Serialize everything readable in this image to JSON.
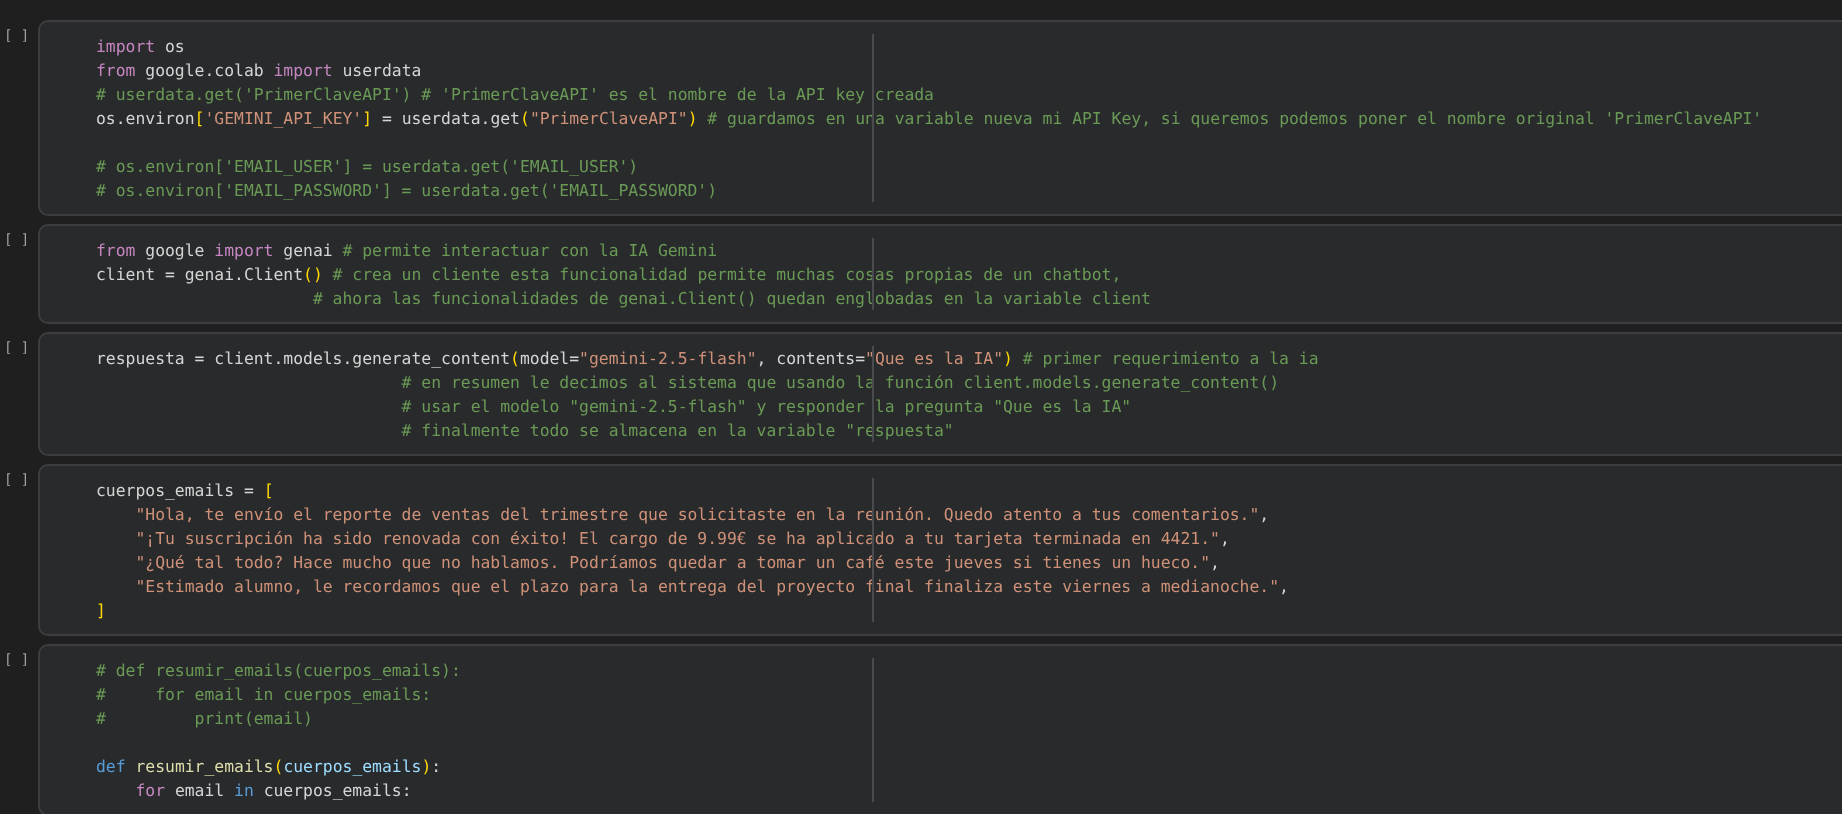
{
  "cells": [
    {
      "run_label": "[ ]",
      "lines": [
        {
          "kind": "code",
          "tokens": [
            {
              "kind": "keyword",
              "text": "import"
            },
            {
              "kind": "plain",
              "text": " os"
            }
          ]
        },
        {
          "kind": "code",
          "tokens": [
            {
              "kind": "keyword",
              "text": "from"
            },
            {
              "kind": "plain",
              "text": " google.colab "
            },
            {
              "kind": "keyword",
              "text": "import"
            },
            {
              "kind": "plain",
              "text": " userdata"
            }
          ]
        },
        {
          "kind": "code",
          "tokens": [
            {
              "kind": "comment",
              "text": "# userdata.get('PrimerClaveAPI') # 'PrimerClaveAPI' es el nombre de la API key creada"
            }
          ]
        },
        {
          "kind": "code",
          "tokens": [
            {
              "kind": "plain",
              "text": "os.environ"
            },
            {
              "kind": "bracket",
              "text": "["
            },
            {
              "kind": "string",
              "text": "'GEMINI_API_KEY'"
            },
            {
              "kind": "bracket",
              "text": "]"
            },
            {
              "kind": "plain",
              "text": " = userdata.get"
            },
            {
              "kind": "bracket",
              "text": "("
            },
            {
              "kind": "string",
              "text": "\"PrimerClaveAPI\""
            },
            {
              "kind": "bracket",
              "text": ")"
            },
            {
              "kind": "comment",
              "text": " # guardamos en una variable nueva mi API Key, si queremos podemos poner el nombre original 'PrimerClaveAPI'"
            }
          ]
        },
        {
          "kind": "blank"
        },
        {
          "kind": "code",
          "tokens": [
            {
              "kind": "comment",
              "text": "# os.environ['EMAIL_USER'] = userdata.get('EMAIL_USER')"
            }
          ]
        },
        {
          "kind": "code",
          "tokens": [
            {
              "kind": "comment",
              "text": "# os.environ['EMAIL_PASSWORD'] = userdata.get('EMAIL_PASSWORD')"
            }
          ]
        }
      ]
    },
    {
      "run_label": "[ ]",
      "lines": [
        {
          "kind": "code",
          "tokens": [
            {
              "kind": "keyword",
              "text": "from"
            },
            {
              "kind": "plain",
              "text": " google "
            },
            {
              "kind": "keyword",
              "text": "import"
            },
            {
              "kind": "plain",
              "text": " genai "
            },
            {
              "kind": "comment",
              "text": "# permite interactuar con la IA Gemini"
            }
          ]
        },
        {
          "kind": "code",
          "tokens": [
            {
              "kind": "plain",
              "text": "client = genai.Client"
            },
            {
              "kind": "bracket",
              "text": "()"
            },
            {
              "kind": "comment",
              "text": " # crea un cliente esta funcionalidad permite muchas cosas propias de un chatbot,"
            }
          ]
        },
        {
          "kind": "code",
          "tokens": [
            {
              "kind": "comment",
              "text": "                      # ahora las funcionalidades de genai.Client() quedan englobadas en la variable client"
            }
          ]
        }
      ]
    },
    {
      "run_label": "[ ]",
      "lines": [
        {
          "kind": "code",
          "tokens": [
            {
              "kind": "plain",
              "text": "respuesta = client.models.generate_content"
            },
            {
              "kind": "bracket",
              "text": "("
            },
            {
              "kind": "plain",
              "text": "model="
            },
            {
              "kind": "string",
              "text": "\"gemini-2.5-flash\""
            },
            {
              "kind": "plain",
              "text": ", contents="
            },
            {
              "kind": "string",
              "text": "\"Que es la IA\""
            },
            {
              "kind": "bracket",
              "text": ")"
            },
            {
              "kind": "comment",
              "text": " # primer requerimiento a la ia"
            }
          ]
        },
        {
          "kind": "code",
          "tokens": [
            {
              "kind": "comment",
              "text": "                               # en resumen le decimos al sistema que usando la función client.models.generate_content()"
            }
          ]
        },
        {
          "kind": "code",
          "tokens": [
            {
              "kind": "comment",
              "text": "                               # usar el modelo \"gemini-2.5-flash\" y responder la pregunta \"Que es la IA\""
            }
          ]
        },
        {
          "kind": "code",
          "tokens": [
            {
              "kind": "comment",
              "text": "                               # finalmente todo se almacena en la variable \"respuesta\""
            }
          ]
        }
      ]
    },
    {
      "run_label": "[ ]",
      "lines": [
        {
          "kind": "code",
          "tokens": [
            {
              "kind": "plain",
              "text": "cuerpos_emails = "
            },
            {
              "kind": "bracket",
              "text": "["
            }
          ]
        },
        {
          "kind": "code",
          "tokens": [
            {
              "kind": "string",
              "text": "    \"Hola, te envío el reporte de ventas del trimestre que solicitaste en la reunión. Quedo atento a tus comentarios.\""
            },
            {
              "kind": "plain",
              "text": ","
            }
          ]
        },
        {
          "kind": "code",
          "tokens": [
            {
              "kind": "string",
              "text": "    \"¡Tu suscripción ha sido renovada con éxito! El cargo de 9.99€ se ha aplicado a tu tarjeta terminada en 4421.\""
            },
            {
              "kind": "plain",
              "text": ","
            }
          ]
        },
        {
          "kind": "code",
          "tokens": [
            {
              "kind": "string",
              "text": "    \"¿Qué tal todo? Hace mucho que no hablamos. Podríamos quedar a tomar un café este jueves si tienes un hueco.\""
            },
            {
              "kind": "plain",
              "text": ","
            }
          ]
        },
        {
          "kind": "code",
          "tokens": [
            {
              "kind": "string",
              "text": "    \"Estimado alumno, le recordamos que el plazo para la entrega del proyecto final finaliza este viernes a medianoche.\""
            },
            {
              "kind": "plain",
              "text": ","
            }
          ]
        },
        {
          "kind": "code",
          "tokens": [
            {
              "kind": "bracket",
              "text": "]"
            }
          ]
        }
      ]
    },
    {
      "run_label": "[ ]",
      "lines": [
        {
          "kind": "code",
          "tokens": [
            {
              "kind": "comment",
              "text": "# def resumir_emails(cuerpos_emails):"
            }
          ]
        },
        {
          "kind": "code",
          "tokens": [
            {
              "kind": "comment",
              "text": "#     for email in cuerpos_emails:"
            }
          ]
        },
        {
          "kind": "code",
          "tokens": [
            {
              "kind": "comment",
              "text": "#         print(email)"
            }
          ]
        },
        {
          "kind": "blank"
        },
        {
          "kind": "code",
          "tokens": [
            {
              "kind": "storage",
              "text": "def"
            },
            {
              "kind": "function",
              "text": " resumir_emails"
            },
            {
              "kind": "bracket",
              "text": "("
            },
            {
              "kind": "param",
              "text": "cuerpos_emails"
            },
            {
              "kind": "bracket",
              "text": ")"
            },
            {
              "kind": "plain",
              "text": ":"
            }
          ]
        },
        {
          "kind": "code",
          "tokens": [
            {
              "kind": "keyword",
              "text": "    for"
            },
            {
              "kind": "plain",
              "text": " email "
            },
            {
              "kind": "storage",
              "text": "in"
            },
            {
              "kind": "plain",
              "text": " cuerpos_emails:"
            }
          ]
        }
      ]
    }
  ]
}
